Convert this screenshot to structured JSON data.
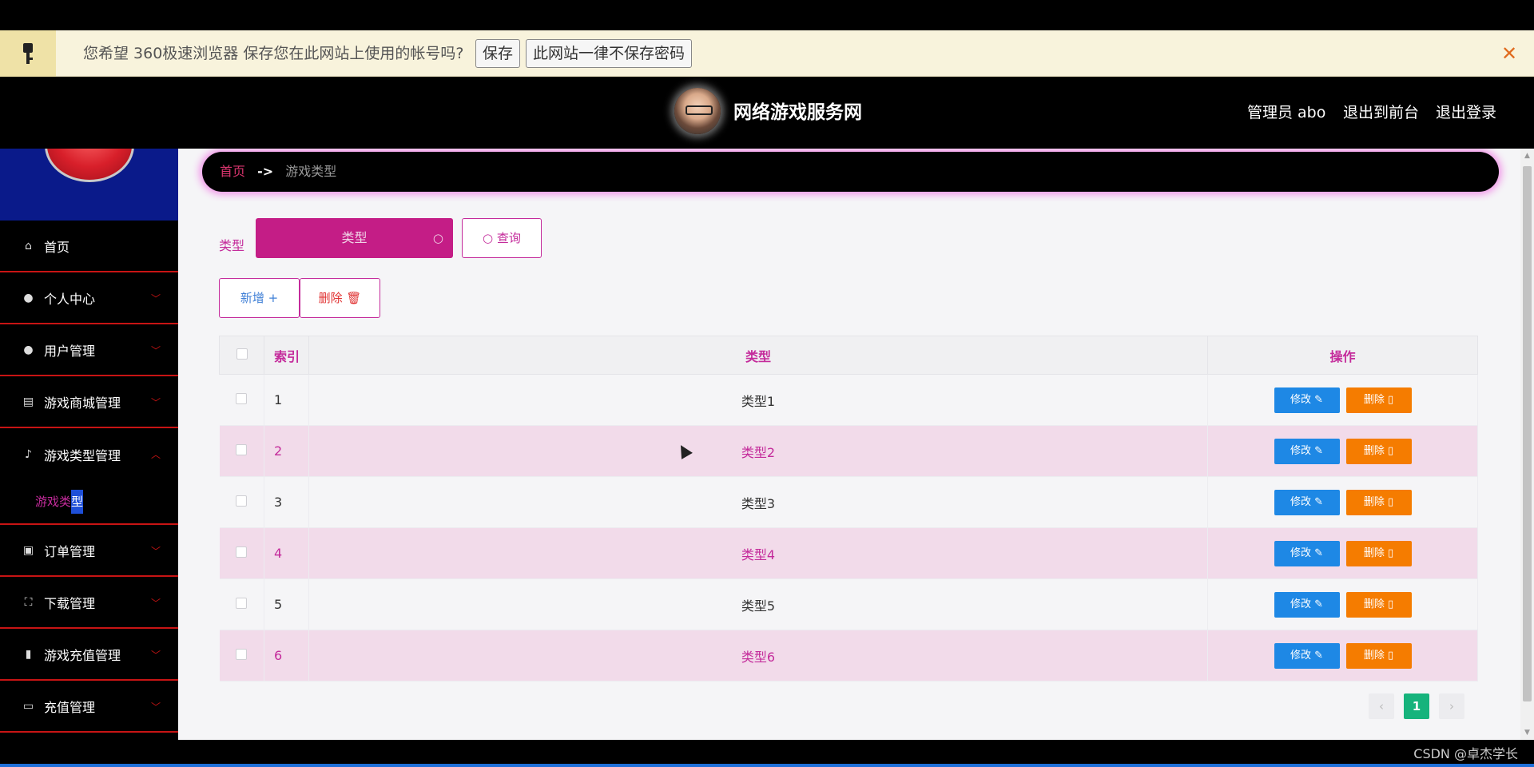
{
  "password_bar": {
    "message": "您希望 360极速浏览器 保存您在此网站上使用的帐号吗?",
    "save_label": "保存",
    "never_label": "此网站一律不保存密码",
    "close_glyph": "✕"
  },
  "header": {
    "title": "网络游戏服务网",
    "admin_label": "管理员 abo",
    "front_label": "退出到前台",
    "logout_label": "退出登录"
  },
  "sidebar": {
    "items": [
      {
        "label": "首页",
        "icon": "home-icon",
        "glyph": "⌂"
      },
      {
        "label": "个人中心",
        "icon": "user-icon",
        "glyph": "●"
      },
      {
        "label": "用户管理",
        "icon": "user-manage-icon",
        "glyph": "●"
      },
      {
        "label": "游戏商城管理",
        "icon": "clipboard-icon",
        "glyph": "▤"
      },
      {
        "label": "游戏类型管理",
        "icon": "microphone-icon",
        "glyph": "♪"
      },
      {
        "label": "订单管理",
        "icon": "order-icon",
        "glyph": "▣"
      },
      {
        "label": "下载管理",
        "icon": "fullscreen-icon",
        "glyph": "⛶"
      },
      {
        "label": "游戏充值管理",
        "icon": "bar-chart-icon",
        "glyph": "▮"
      },
      {
        "label": "充值管理",
        "icon": "card-icon",
        "glyph": "▭"
      }
    ],
    "submenu": {
      "label_a": "游戏类",
      "label_b": "型"
    }
  },
  "breadcrumb": {
    "home": "首页",
    "sep": "->",
    "current": "游戏类型"
  },
  "search": {
    "label": "类型",
    "placeholder": "类型",
    "query_label": "查询"
  },
  "actions": {
    "add_label": "新增",
    "delete_label": "删除"
  },
  "table": {
    "headers": {
      "index": "索引",
      "type": "类型",
      "op": "操作"
    },
    "rows": [
      {
        "index": "1",
        "type": "类型1"
      },
      {
        "index": "2",
        "type": "类型2"
      },
      {
        "index": "3",
        "type": "类型3"
      },
      {
        "index": "4",
        "type": "类型4"
      },
      {
        "index": "5",
        "type": "类型5"
      },
      {
        "index": "6",
        "type": "类型6"
      }
    ],
    "edit_label": "修改",
    "delete_label": "删除"
  },
  "pager": {
    "current": "1",
    "prev": "‹",
    "next": "›"
  },
  "watermark": "CSDN @卓杰学长",
  "colors": {
    "accent": "#c42b9b",
    "edit": "#1e88e5",
    "delete": "#f57c00",
    "pager_active": "#16b37c"
  }
}
